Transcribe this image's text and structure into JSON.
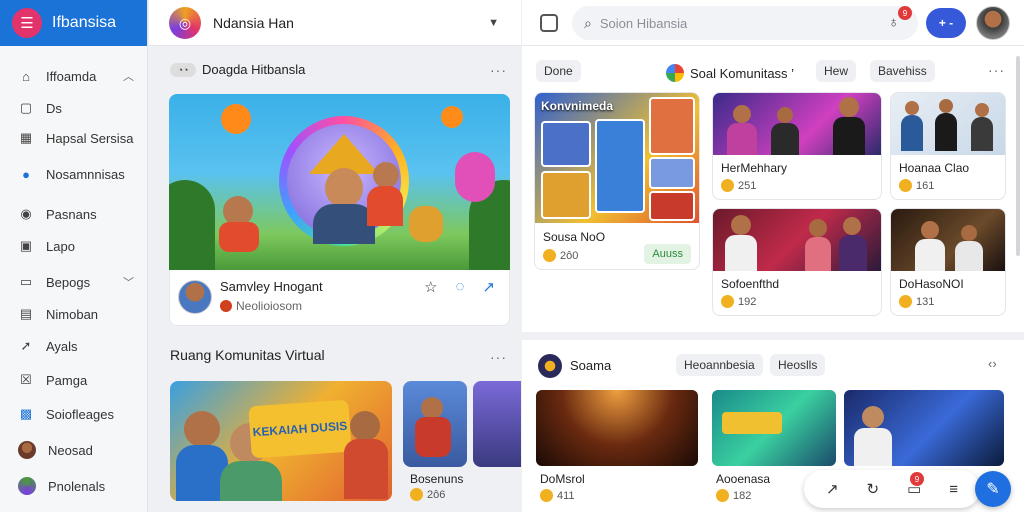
{
  "app": {
    "name": "Ifbansisa",
    "logo_icon": "menu-icon",
    "brand_color": "#1b73d8"
  },
  "sidebar": {
    "items": [
      {
        "label": "Iffoamda",
        "icon": "home-icon",
        "expandable": true
      },
      {
        "label": "Ds",
        "icon": "folder-icon"
      },
      {
        "label": "Hapsal Sersisa",
        "icon": "calendar-icon"
      },
      {
        "label": "Nosamnnisas",
        "icon": "community-icon"
      },
      {
        "label": "Pasnans",
        "icon": "circle-icon"
      },
      {
        "label": "Lapo",
        "icon": "image-icon"
      },
      {
        "label": "Bepogs",
        "icon": "chat-icon",
        "expandable": true
      },
      {
        "label": "Nimoban",
        "icon": "book-icon"
      },
      {
        "label": "Ayals",
        "icon": "send-icon"
      },
      {
        "label": "Pamga",
        "icon": "close-box-icon"
      },
      {
        "label": "Soiofleages",
        "icon": "group-icon"
      },
      {
        "label": "Neosad",
        "icon": "user-avatar"
      },
      {
        "label": "Pnolenals",
        "icon": "profile-avatar"
      }
    ]
  },
  "center": {
    "profile_select": {
      "name": "Ndansia Han"
    },
    "card1": {
      "header_label": "Doagda Hitbansla",
      "creator_name": "Samvley Hnogant",
      "creator_sub": "Neolioiosom"
    },
    "section2": {
      "title": "Ruang Komunitas Virtual",
      "banner_text": "KEKAIAH DUSIS",
      "side_label": "Bosenuns",
      "side_meta": "2ô6"
    }
  },
  "right": {
    "search": {
      "placeholder": "Soion Hibansia"
    },
    "notif_count": "9",
    "plus_label": "+ -",
    "section1": {
      "chip_left": "Done",
      "title": "Soal Komunitass ’",
      "chip_mid": "Hew",
      "chip_right": "Bavehiss",
      "collage": {
        "title": "Konvnimeda",
        "label": "Sousa NoO",
        "meta": "2ô0",
        "button": "Auuss"
      },
      "cards": [
        {
          "label": "HerMehhary",
          "meta": "251"
        },
        {
          "label": "Hoanaa Clao",
          "meta": "161"
        },
        {
          "label": "Sofoenfthd",
          "meta": "192"
        },
        {
          "label": "DoHasoNOI",
          "meta": "131"
        }
      ]
    },
    "section2": {
      "title": "Soama",
      "chip_a": "Heoannbesia",
      "chip_b": "Heoslls",
      "cards": [
        {
          "label": "DoMsrol",
          "meta": "411"
        },
        {
          "label": "Aooenasa",
          "meta": "182"
        }
      ]
    }
  },
  "float_bar": {
    "badge": "9",
    "icons": [
      "share-icon",
      "refresh-icon",
      "inbox-icon",
      "stack-icon"
    ]
  },
  "colors": {
    "accent": "#3559d8",
    "fab": "#1f6fe0",
    "badge": "#e03a3a"
  }
}
